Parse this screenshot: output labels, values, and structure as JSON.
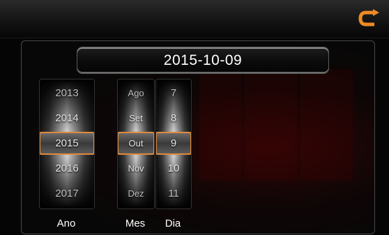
{
  "date_display": "2015-10-09",
  "back_icon": "back-arrow-icon",
  "accent_color": "#f08a24",
  "wheels": [
    {
      "label": "Ano",
      "items": [
        "2013",
        "2014",
        "2015",
        "2016",
        "2017"
      ],
      "selected": "2015"
    },
    {
      "label": "Mes",
      "items": [
        "Ago",
        "Set",
        "Out",
        "Nov",
        "Dez"
      ],
      "selected": "Out"
    },
    {
      "label": "Dia",
      "items": [
        "7",
        "8",
        "9",
        "10",
        "11"
      ],
      "selected": "9"
    }
  ]
}
